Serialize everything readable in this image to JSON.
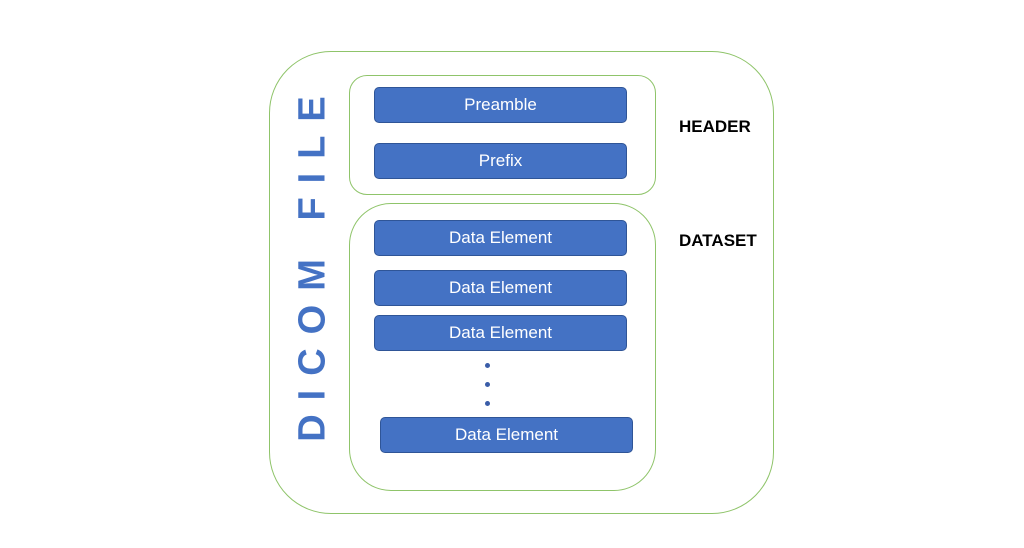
{
  "diagram": {
    "title": "DICOM FILE",
    "sections": {
      "header": {
        "label": "HEADER",
        "blocks": [
          "Preamble",
          "Prefix"
        ]
      },
      "dataset": {
        "label": "DATASET",
        "blocks": [
          "Data Element",
          "Data Element",
          "Data Element",
          "Data Element"
        ],
        "ellipsis": "⋮"
      }
    },
    "colors": {
      "block": "#4472c4",
      "border": "#8fc46a",
      "title": "#4472c4"
    }
  }
}
